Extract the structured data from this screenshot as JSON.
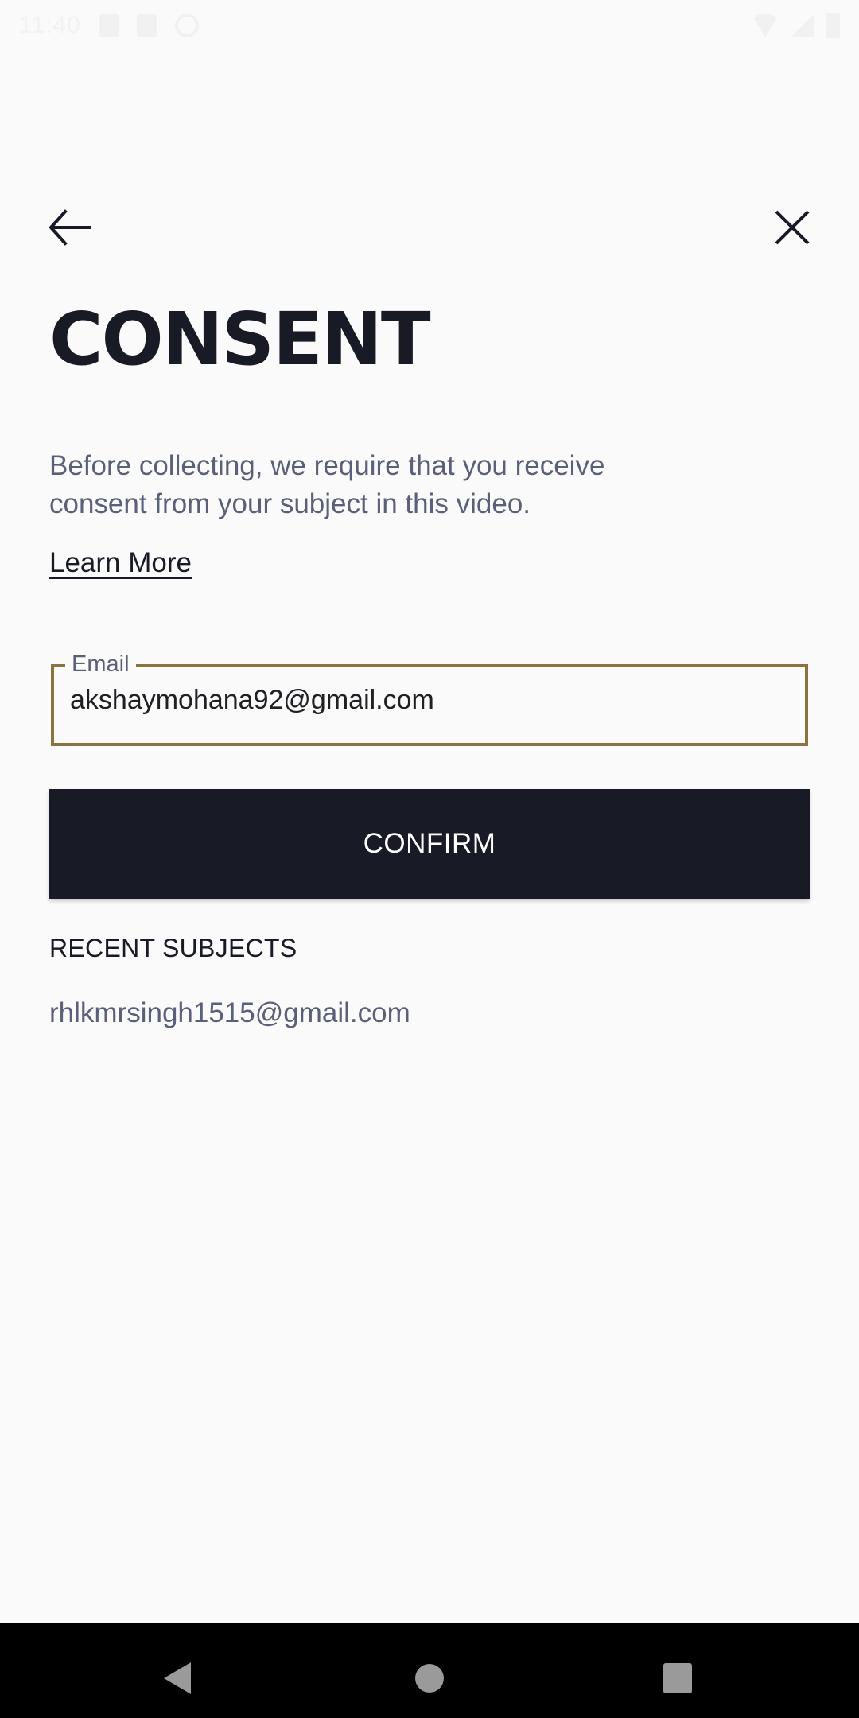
{
  "status_bar": {
    "time": "11:40",
    "left_icons": [
      "notification-icon",
      "notification-icon",
      "notification-icon"
    ],
    "right_icons": [
      "wifi-icon",
      "signal-icon",
      "battery-icon"
    ]
  },
  "header": {
    "back_icon": "arrow-left-icon",
    "close_icon": "close-icon"
  },
  "page": {
    "title": "CONSENT",
    "description": "Before collecting, we require that you receive consent from your subject in this video.",
    "learn_more_label": "Learn More"
  },
  "email_field": {
    "label": "Email",
    "value": "akshaymohana92@gmail.com",
    "border_color": "#8b7340"
  },
  "confirm_button": {
    "label": "CONFIRM",
    "background": "#181a26"
  },
  "recent_subjects": {
    "heading": "RECENT SUBJECTS",
    "items": [
      "rhlkmrsingh1515@gmail.com"
    ]
  },
  "nav_bar": {
    "buttons": [
      "back",
      "home",
      "recents"
    ]
  }
}
